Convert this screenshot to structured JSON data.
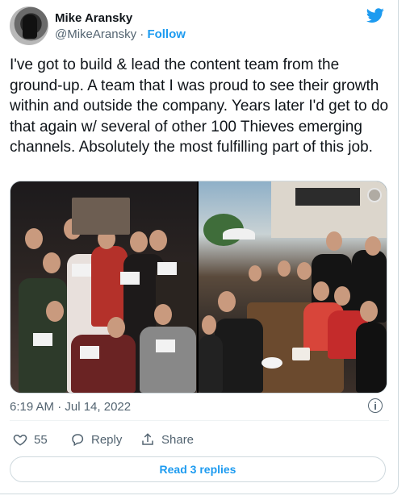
{
  "author": {
    "name": "Mike Aransky",
    "handle": "@MikeAransky",
    "separator": "·",
    "follow_label": "Follow"
  },
  "tweet": {
    "text": "I've got to build & lead the content team from the ground-up. A team that I was proud to see their growth within and outside the company. Years later I'd get to do that again w/ several of other 100 Thieves emerging channels. Absolutely the most fulfilling part of this job.",
    "timestamp": "6:19 AM · Jul 14, 2022"
  },
  "media": {
    "count": 2
  },
  "actions": {
    "like_count": "55",
    "reply_label": "Reply",
    "share_label": "Share"
  },
  "replies_button": "Read 3 replies",
  "colors": {
    "accent": "#1d9bf0",
    "text": "#0f1419",
    "muted": "#536471",
    "border": "#cfd9de"
  },
  "icons": [
    "twitter-logo-icon",
    "info-icon",
    "heart-icon",
    "reply-icon",
    "share-icon",
    "clock-icon"
  ]
}
